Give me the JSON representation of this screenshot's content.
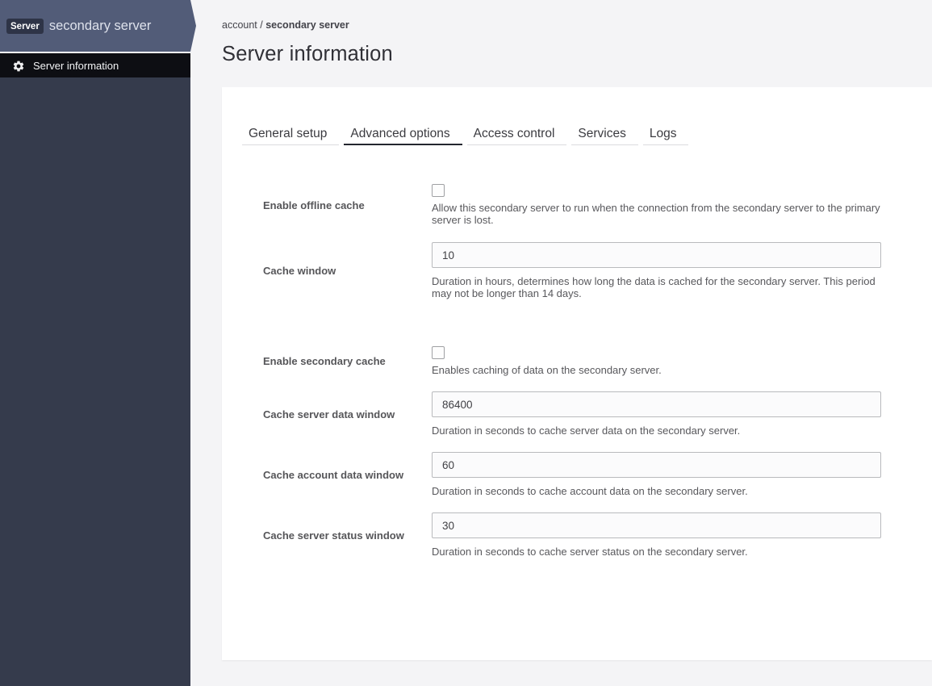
{
  "colors": {
    "sidebar_header": "#525c78",
    "sidebar_body": "#353b4c",
    "sidebar_menu_bar": "#0d0e13",
    "badge_bg": "#2e3447",
    "page_bg": "#f4f4f6",
    "card_bg": "#ffffff",
    "active_tab_underline": "#24262f"
  },
  "sidebar": {
    "badge": "Server",
    "server_name": "secondary server",
    "menu": [
      {
        "label": "Server information",
        "icon": "gear-icon",
        "active": true
      }
    ]
  },
  "breadcrumb": {
    "section": "account",
    "separator": " / ",
    "current": "secondary server"
  },
  "page": {
    "title": "Server information"
  },
  "tabs": [
    {
      "label": "General setup",
      "active": false
    },
    {
      "label": "Advanced options",
      "active": true
    },
    {
      "label": "Access control",
      "active": false
    },
    {
      "label": "Services",
      "active": false
    },
    {
      "label": "Logs",
      "active": false
    }
  ],
  "form": {
    "rows": [
      {
        "type": "checkbox",
        "label": "Enable offline cache",
        "checked": false,
        "help": "Allow this secondary server to run when the connection from the secondary server to the primary server is lost."
      },
      {
        "type": "text",
        "label": "Cache window",
        "value": "10",
        "help": "Duration in hours, determines how long the data is cached for the secondary server. This period may not be longer than 14 days."
      },
      {
        "type": "checkbox",
        "label": "Enable secondary cache",
        "checked": false,
        "help": "Enables caching of data on the secondary server."
      },
      {
        "type": "text",
        "label": "Cache server data window",
        "value": "86400",
        "help": "Duration in seconds to cache server data on the secondary server."
      },
      {
        "type": "text",
        "label": "Cache account data window",
        "value": "60",
        "help": "Duration in seconds to cache account data on the secondary server."
      },
      {
        "type": "text",
        "label": "Cache server status window",
        "value": "30",
        "help": "Duration in seconds to cache server status on the secondary server."
      }
    ]
  }
}
